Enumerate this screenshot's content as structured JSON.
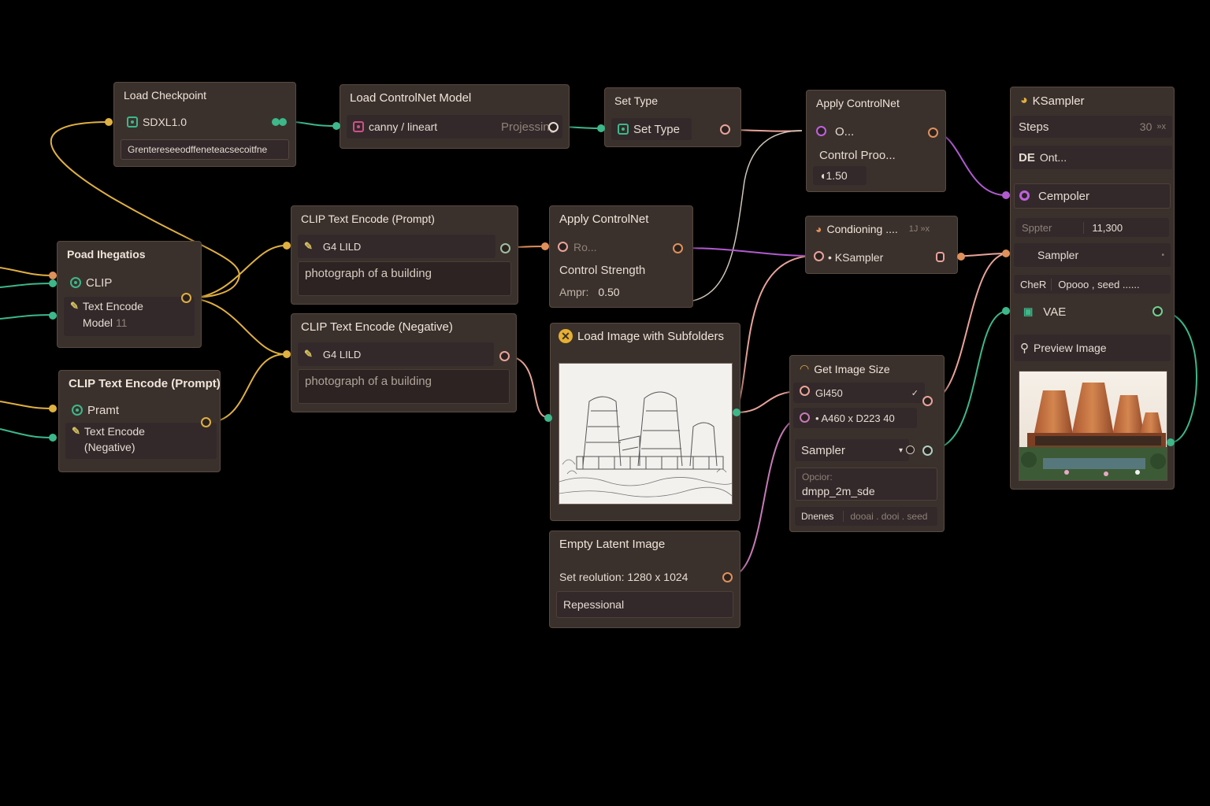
{
  "nodes": {
    "load_checkpoint": {
      "title": "Load Checkpoint",
      "model": "SDXL1.0",
      "field": "Grentereseeodffeneteacsecoitfne"
    },
    "load_controlnet": {
      "title": "Load ControlNet Model",
      "model": "canny / lineart",
      "status": "Projessing"
    },
    "set_type": {
      "title": "Set Type",
      "label": "Set Type"
    },
    "apply_cn_top": {
      "title": "Apply ControlNet",
      "input": "O...",
      "label": "Control Proo...",
      "value": "◖1.50"
    },
    "ksampler": {
      "title": "KSampler",
      "steps_label": "Steps",
      "steps_value": "30",
      "steps_unit": "»x",
      "de_label": "DE",
      "de_value": "Ont...",
      "cempoler": "Cempoler",
      "sppter_label": "Sppter",
      "sppter_value": "11,300",
      "sampler": "Sampler",
      "cher_label": "CheR",
      "cher_value": "Opooo , seed ......",
      "vae": "VAE",
      "preview": "Preview Image"
    },
    "poad_negation": {
      "title": "Poad Ihegatios",
      "clip": "CLIP",
      "text_encode": "Text Encode",
      "model": "Model",
      "model_num": "11"
    },
    "clip_prompt": {
      "title": "CLIP Text Encode (Prompt)",
      "clip": "G4 LILD",
      "text": "photograph of a building"
    },
    "apply_cn_mid": {
      "title": "Apply ControlNet",
      "input": "Ro...",
      "strength_label": "Control Strength",
      "ampr_label": "Ampr:",
      "ampr_value": "0.50"
    },
    "conditioning": {
      "title": "Condioning ....",
      "badge": "1J »x",
      "output": "• KSampler"
    },
    "clip_negative": {
      "title": "CLIP Text Encode (Negative)",
      "clip": "G4 LILD",
      "text": "photograph of a building"
    },
    "load_image": {
      "title": "Load Image with Subfolders"
    },
    "clip_prompt_left": {
      "title": "CLIP Text Encode (Prompt)",
      "pramt": "Pramt",
      "text_encode": "Text Encode",
      "negative": "(Negative)"
    },
    "get_image_size": {
      "title": "Get Image Size",
      "width": "Gl450",
      "dims": "• A460 x D223 40",
      "sampler": "Sampler",
      "opcion_label": "Opcior:",
      "opcion_value": "dmpp_2m_sde",
      "denter_label": "Dnenes",
      "denter_value": "dooai . dooi . seed"
    },
    "empty_latent": {
      "title": "Empty Latent Image",
      "resolution": "Set reolution: 1280 x 1024",
      "field": "Repessional"
    }
  },
  "colors": {
    "background": "#000000",
    "node": "#3b312c",
    "wire_yellow": "#e0b040",
    "wire_green": "#3cb88a",
    "wire_pink": "#e9a39a",
    "wire_purple": "#b05ad0",
    "wire_orange": "#e0905a"
  }
}
